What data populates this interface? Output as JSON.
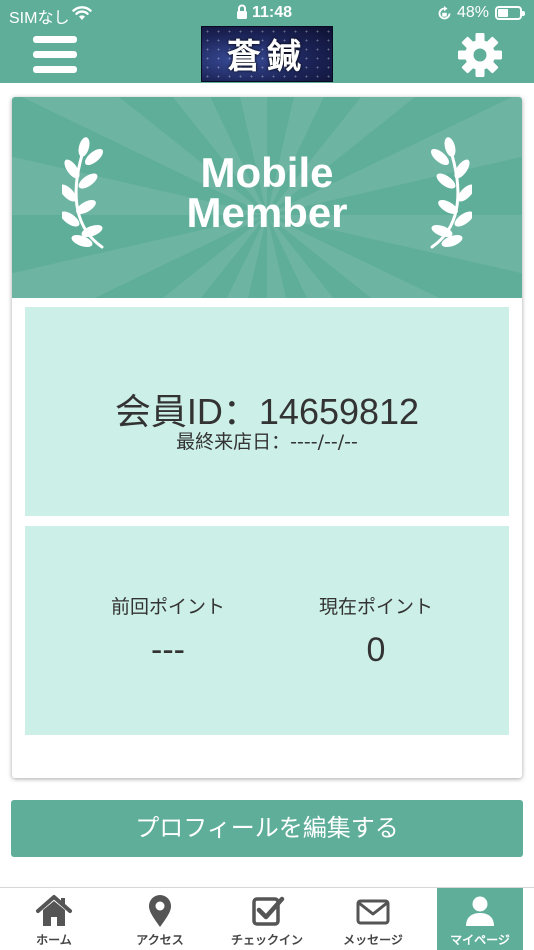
{
  "status_bar": {
    "carrier": "SIMなし",
    "time": "11:48",
    "battery": "48%",
    "battery_level": 0.48
  },
  "header": {
    "logo_text": "蒼鍼",
    "menu_icon": "hamburger-menu-icon",
    "settings_icon": "gear-icon"
  },
  "card": {
    "banner_line1": "Mobile",
    "banner_line2": "Member",
    "member_id": "会員ID：14659812",
    "last_visit": "最終来店日：----/--/--",
    "previous_points_label": "前回ポイント",
    "previous_points_value": "---",
    "current_points_label": "現在ポイント",
    "current_points_value": "0"
  },
  "edit_profile_label": "プロフィールを編集する",
  "tabs": [
    {
      "label": "ホーム",
      "icon": "home-icon",
      "active": false
    },
    {
      "label": "アクセス",
      "icon": "map-pin-icon",
      "active": false
    },
    {
      "label": "チェックイン",
      "icon": "checkin-icon",
      "active": false
    },
    {
      "label": "メッセージ",
      "icon": "envelope-icon",
      "active": false
    },
    {
      "label": "マイページ",
      "icon": "user-icon",
      "active": true
    }
  ],
  "colors": {
    "primary": "#5fae99",
    "panel": "#ccefe7",
    "tab_icon": "#555555"
  }
}
